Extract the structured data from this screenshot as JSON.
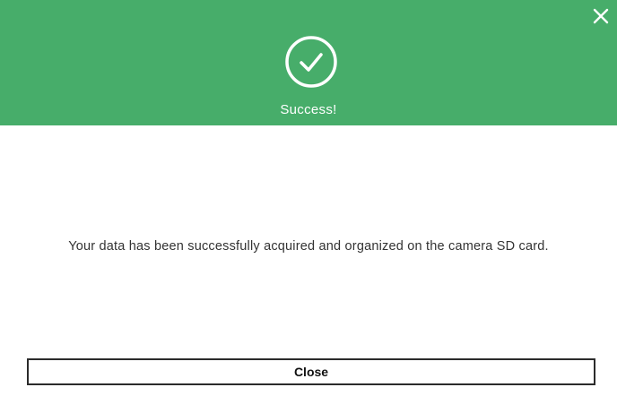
{
  "dialog": {
    "header_color": "#47ad6a",
    "title": "Success!",
    "status_icon": "checkmark-circle-icon",
    "close_icon": "close-icon",
    "message": "Your data has been successfully acquired and organized on the camera SD card.",
    "close_button_label": "Close"
  }
}
